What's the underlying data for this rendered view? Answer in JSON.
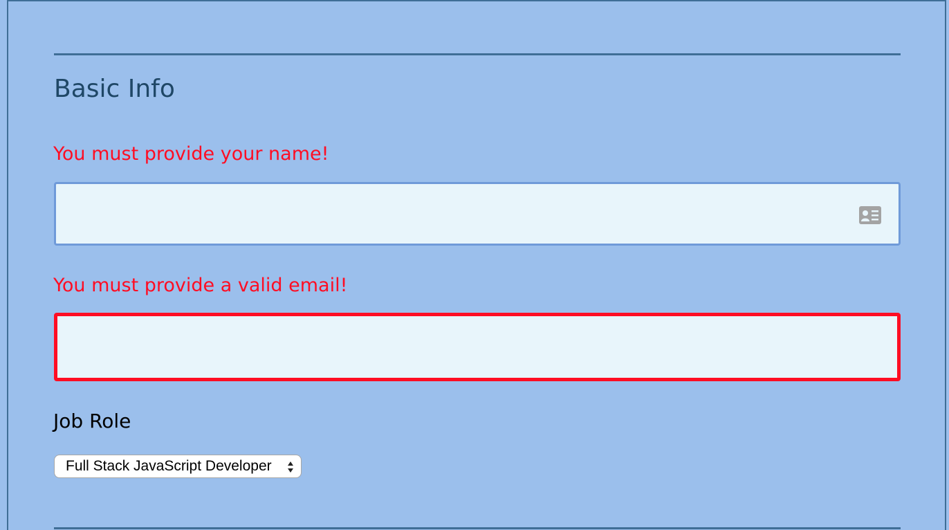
{
  "form": {
    "section_title": "Basic Info",
    "name_error": "You must provide your name!",
    "name_value": "",
    "email_error": "You must provide a valid email!",
    "email_value": "",
    "job_label": "Job Role",
    "job_selected": "Full Stack JavaScript Developer"
  },
  "icons": {
    "name_field_icon": "contact-card-icon",
    "select_arrows": "up-down-arrows-icon"
  },
  "colors": {
    "background": "#9bbfec",
    "border_dark": "#3f6e96",
    "title": "#1f4766",
    "error": "#ff0d23",
    "field_bg": "#e8f5fb",
    "field_focus_border": "#6f9ad9"
  }
}
